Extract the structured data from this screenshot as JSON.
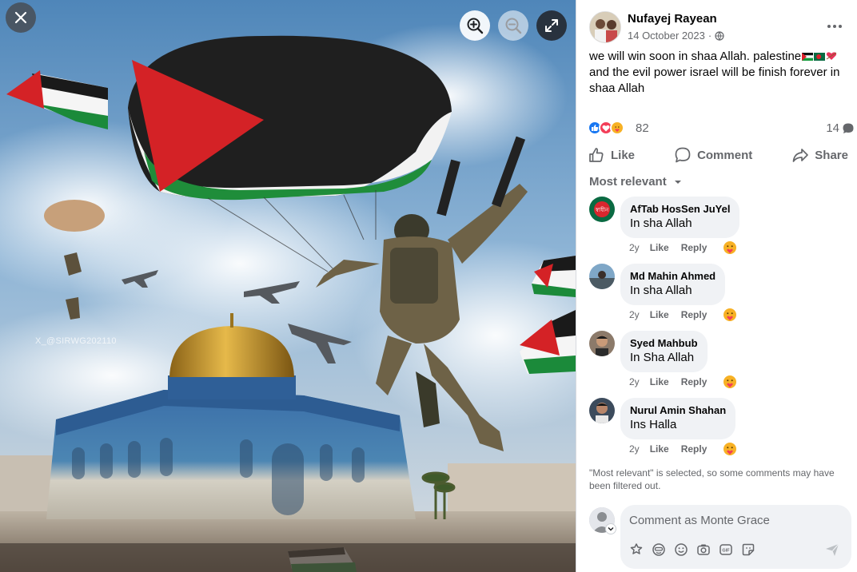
{
  "viewer": {
    "watermark": "X_@SIRWG202110",
    "controls": {
      "close_icon": "close-icon",
      "zoom_in_icon": "zoom-in-icon",
      "zoom_out_icon": "zoom-out-icon",
      "expand_icon": "expand-icon"
    }
  },
  "post": {
    "author": "Nufayej Rayean",
    "date": "14 October 2023",
    "audience_icon": "globe-icon",
    "caption_part1": "we will win soon in shaa Allah. palestine",
    "caption_part2": "and the evil power israel will be finish forever in shaa Allah",
    "reaction_count": "82",
    "comment_count": "14"
  },
  "actions": {
    "like": "Like",
    "comment": "Comment",
    "share": "Share"
  },
  "filter": {
    "label": "Most relevant"
  },
  "comments": [
    {
      "name": "AfTab HosSen JuYel",
      "text": "In sha Allah",
      "time": "2y",
      "like": "Like",
      "reply": "Reply"
    },
    {
      "name": "Md Mahin Ahmed",
      "text": "In sha Allah",
      "time": "2y",
      "like": "Like",
      "reply": "Reply"
    },
    {
      "name": "Syed Mahbub",
      "text": "In Sha Allah",
      "time": "2y",
      "like": "Like",
      "reply": "Reply"
    },
    {
      "name": "Nurul Amin Shahan",
      "text": "Ins Halla",
      "time": "2y",
      "like": "Like",
      "reply": "Reply"
    }
  ],
  "filter_note": "\"Most relevant\" is selected, so some comments may have been filtered out.",
  "composer": {
    "placeholder": "Comment as Monte Grace"
  },
  "colors": {
    "text_secondary": "#65676b",
    "bubble": "#f0f2f5",
    "like_blue": "#1877f2",
    "love_red": "#f33e58",
    "care_yellow": "#f7b125"
  }
}
